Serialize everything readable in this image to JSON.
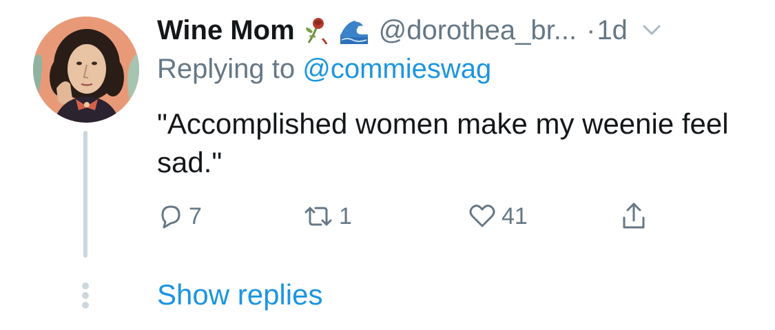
{
  "tweet": {
    "display_name": "Wine Mom",
    "name_emojis": [
      "wilted-rose-icon",
      "wave-icon"
    ],
    "handle": "@dorothea_br...",
    "separator": "·",
    "timestamp": "1d",
    "replying_prefix": "Replying to",
    "replying_mention": "@commieswag",
    "text": "\"Accomplished women make my weenie feel sad.\""
  },
  "actions": {
    "replies": "7",
    "retweets": "1",
    "likes": "41"
  },
  "footer": {
    "show_replies": "Show replies"
  },
  "colors": {
    "text": "#14171a",
    "secondary": "#657786",
    "link": "#1b95e0",
    "thread_line": "#ccd6dd"
  }
}
